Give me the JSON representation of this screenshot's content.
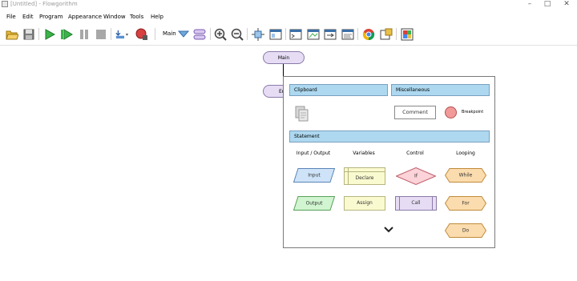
{
  "window": {
    "title": "[Untitled] - Flowgorithm",
    "minimize": "–",
    "maximize": "□",
    "close": "✕"
  },
  "menu": {
    "items": [
      "File",
      "Edit",
      "Program",
      "Appearance",
      "Window",
      "Tools",
      "Help"
    ]
  },
  "toolbar": {
    "function_selector": "Main",
    "icons": [
      "open-folder",
      "save",
      "run",
      "step",
      "pause",
      "stop",
      "variable-watch",
      "breakpoint",
      "function-select",
      "manage-functions",
      "zoom-in",
      "zoom-out",
      "fit-to-screen",
      "layout",
      "console",
      "variable-watch-window",
      "output-window",
      "source-code",
      "chrome-browser",
      "export",
      "flowchart-style"
    ]
  },
  "canvas": {
    "nodes": {
      "main": "Main",
      "end": "End"
    }
  },
  "insert_popup": {
    "sections": {
      "clipboard": "Clipboard",
      "miscellaneous": "Miscellaneous",
      "statement": "Statement"
    },
    "misc": {
      "comment": "Comment",
      "breakpoint": "Breakpoint"
    },
    "columns": [
      "Input / Output",
      "Variables",
      "Control",
      "Looping"
    ],
    "shapes": {
      "input": "Input",
      "output": "Output",
      "declare": "Declare",
      "assign": "Assign",
      "if": "If",
      "call": "Call",
      "while": "While",
      "for": "For",
      "do": "Do"
    },
    "more_indicator": "⌄"
  },
  "colors": {
    "section_bar": "#add8f0",
    "io_shape": "#cfe3f8",
    "output_shape": "#d0f5d0",
    "variable_shape": "#fafad0",
    "control_shape": "#fbd3d8",
    "call_shape": "#e6ddf5",
    "loop_shape": "#fbdcae",
    "breakpoint": "#f29a9a"
  }
}
